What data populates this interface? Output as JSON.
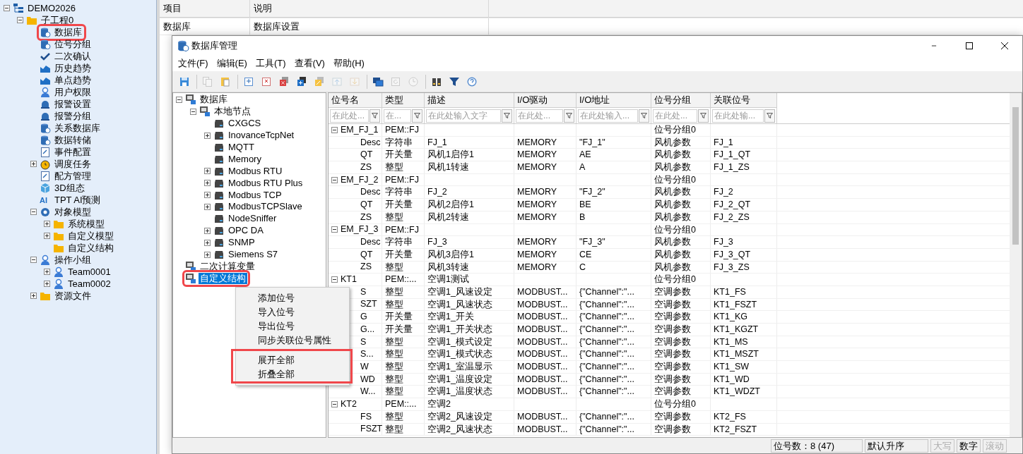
{
  "project_tree": [
    {
      "label": "DEMO2026",
      "kind": "hierarchy",
      "expanded": true,
      "highlighted": false,
      "children": [
        {
          "label": "子工程0",
          "kind": "folder",
          "expanded": true,
          "highlighted": false,
          "children": [
            {
              "label": "数据库",
              "kind": "cylinder",
              "highlighted": true
            },
            {
              "label": "位号分组",
              "kind": "cylinder",
              "highlighted": false
            },
            {
              "label": "二次确认",
              "kind": "checkmark",
              "highlighted": false
            },
            {
              "label": "历史趋势",
              "kind": "chart",
              "highlighted": false
            },
            {
              "label": "单点趋势",
              "kind": "chart",
              "highlighted": false
            },
            {
              "label": "用户权限",
              "kind": "user",
              "highlighted": false
            },
            {
              "label": "报警设置",
              "kind": "bell",
              "highlighted": false
            },
            {
              "label": "报警分组",
              "kind": "bell",
              "highlighted": false
            },
            {
              "label": "关系数据库",
              "kind": "cylinder",
              "highlighted": false
            },
            {
              "label": "数据转储",
              "kind": "cylinder",
              "highlighted": false
            },
            {
              "label": "事件配置",
              "kind": "document",
              "highlighted": false
            },
            {
              "label": "调度任务",
              "kind": "clock",
              "expanded": false,
              "highlighted": false
            },
            {
              "label": "配方管理",
              "kind": "document",
              "highlighted": false
            },
            {
              "label": "3D组态",
              "kind": "cube",
              "highlighted": false
            },
            {
              "label": "TPT AI预测",
              "kind": "text",
              "icon_text": "AI",
              "highlighted": false
            },
            {
              "label": "对象模型",
              "kind": "target",
              "expanded": true,
              "highlighted": false,
              "children": [
                {
                  "label": "系统模型",
                  "kind": "folder",
                  "expanded": false,
                  "highlighted": false
                },
                {
                  "label": "自定义模型",
                  "kind": "folder",
                  "expanded": false,
                  "highlighted": false
                },
                {
                  "label": "自定义结构",
                  "kind": "folder",
                  "highlighted": false
                }
              ]
            },
            {
              "label": "操作小组",
              "kind": "user",
              "expanded": true,
              "highlighted": false,
              "children": [
                {
                  "label": "Team0001",
                  "kind": "user",
                  "expanded": false,
                  "highlighted": false
                },
                {
                  "label": "Team0002",
                  "kind": "user",
                  "expanded": false,
                  "highlighted": false
                }
              ]
            },
            {
              "label": "资源文件",
              "kind": "folder",
              "expanded": false,
              "highlighted": false
            }
          ]
        }
      ]
    }
  ],
  "settings_list": {
    "columns": [
      "项目",
      "说明"
    ],
    "rows": [
      [
        "数据库",
        "数据库设置"
      ]
    ]
  },
  "dialog": {
    "title": "数据库管理",
    "menu": [
      "文件(F)",
      "编辑(E)",
      "工具(T)",
      "查看(V)",
      "帮助(H)"
    ],
    "toolbar": [
      {
        "kind": "save",
        "disabled": false
      },
      {
        "kind": "separator"
      },
      {
        "kind": "copy",
        "disabled": true
      },
      {
        "kind": "paste",
        "disabled": false
      },
      {
        "kind": "separator"
      },
      {
        "kind": "add",
        "disabled": false
      },
      {
        "kind": "delete",
        "disabled": false
      },
      {
        "kind": "remove",
        "disabled": false
      },
      {
        "kind": "insert",
        "disabled": false
      },
      {
        "kind": "edit",
        "disabled": false
      },
      {
        "kind": "up",
        "disabled": true
      },
      {
        "kind": "down",
        "disabled": true
      },
      {
        "kind": "separator"
      },
      {
        "kind": "monitor",
        "disabled": false
      },
      {
        "kind": "refresh",
        "disabled": true
      },
      {
        "kind": "history",
        "disabled": true
      },
      {
        "kind": "separator"
      },
      {
        "kind": "find",
        "disabled": false
      },
      {
        "kind": "filter",
        "disabled": false
      },
      {
        "kind": "help",
        "disabled": false
      }
    ],
    "tree": [
      {
        "label": "数据库",
        "kind": "computer",
        "expanded": true,
        "selected": false,
        "highlighted": false,
        "children": [
          {
            "label": "本地节点",
            "kind": "computer",
            "expanded": true,
            "selected": false,
            "highlighted": false,
            "children": [
              {
                "label": "CXGCS",
                "kind": "device",
                "selected": false,
                "highlighted": false
              },
              {
                "label": "InovanceTcpNet",
                "kind": "device",
                "expanded": false,
                "selected": false,
                "highlighted": false
              },
              {
                "label": "MQTT",
                "kind": "device",
                "selected": false,
                "highlighted": false
              },
              {
                "label": "Memory",
                "kind": "device",
                "selected": false,
                "highlighted": false
              },
              {
                "label": "Modbus RTU",
                "kind": "device",
                "expanded": false,
                "selected": false,
                "highlighted": false
              },
              {
                "label": "Modbus RTU Plus",
                "kind": "device",
                "expanded": false,
                "selected": false,
                "highlighted": false
              },
              {
                "label": "Modbus TCP",
                "kind": "device",
                "expanded": false,
                "selected": false,
                "highlighted": false
              },
              {
                "label": "ModbusTCPSlave",
                "kind": "device",
                "expanded": false,
                "selected": false,
                "highlighted": false
              },
              {
                "label": "NodeSniffer",
                "kind": "device",
                "selected": false,
                "highlighted": false
              },
              {
                "label": "OPC DA",
                "kind": "device",
                "expanded": false,
                "selected": false,
                "highlighted": false
              },
              {
                "label": "SNMP",
                "kind": "device",
                "expanded": false,
                "selected": false,
                "highlighted": false
              },
              {
                "label": "Siemens S7",
                "kind": "device",
                "expanded": false,
                "selected": false,
                "highlighted": false
              }
            ]
          }
        ]
      },
      {
        "label": "二次计算变量",
        "kind": "computer",
        "selected": false,
        "highlighted": false
      },
      {
        "label": "自定义结构",
        "kind": "computer",
        "selected": true,
        "highlighted": true
      }
    ],
    "columns": [
      {
        "label": "位号名",
        "placeholder": "在此处..."
      },
      {
        "label": "类型",
        "placeholder": "在..."
      },
      {
        "label": "描述",
        "placeholder": "在此处输入文字"
      },
      {
        "label": "I/O驱动",
        "placeholder": "在此处..."
      },
      {
        "label": "I/O地址",
        "placeholder": "在此处输入..."
      },
      {
        "label": "位号分组",
        "placeholder": "在此处..."
      },
      {
        "label": "关联位号",
        "placeholder": "在此处输..."
      }
    ],
    "groups": [
      {
        "name": "EM_FJ_1",
        "type": "PEM::FJ",
        "group": "位号分组0",
        "expanded": true,
        "children": [
          {
            "name": "Desc",
            "type": "字符串",
            "description": "FJ_1",
            "driver": "MEMORY",
            "address": "\"FJ_1\"",
            "group": "风机参数",
            "linked": "FJ_1"
          },
          {
            "name": "QT",
            "type": "开关量",
            "description": "风机1启停1",
            "driver": "MEMORY",
            "address": "AE",
            "group": "风机参数",
            "linked": "FJ_1_QT"
          },
          {
            "name": "ZS",
            "type": "整型",
            "description": "风机1转速",
            "driver": "MEMORY",
            "address": "A",
            "group": "风机参数",
            "linked": "FJ_1_ZS"
          }
        ]
      },
      {
        "name": "EM_FJ_2",
        "type": "PEM::FJ",
        "group": "位号分组0",
        "expanded": true,
        "children": [
          {
            "name": "Desc",
            "type": "字符串",
            "description": "FJ_2",
            "driver": "MEMORY",
            "address": "\"FJ_2\"",
            "group": "风机参数",
            "linked": "FJ_2"
          },
          {
            "name": "QT",
            "type": "开关量",
            "description": "风机2启停1",
            "driver": "MEMORY",
            "address": "BE",
            "group": "风机参数",
            "linked": "FJ_2_QT"
          },
          {
            "name": "ZS",
            "type": "整型",
            "description": "风机2转速",
            "driver": "MEMORY",
            "address": "B",
            "group": "风机参数",
            "linked": "FJ_2_ZS"
          }
        ]
      },
      {
        "name": "EM_FJ_3",
        "type": "PEM::FJ",
        "group": "位号分组0",
        "expanded": true,
        "children": [
          {
            "name": "Desc",
            "type": "字符串",
            "description": "FJ_3",
            "driver": "MEMORY",
            "address": "\"FJ_3\"",
            "group": "风机参数",
            "linked": "FJ_3"
          },
          {
            "name": "QT",
            "type": "开关量",
            "description": "风机3启停1",
            "driver": "MEMORY",
            "address": "CE",
            "group": "风机参数",
            "linked": "FJ_3_QT"
          },
          {
            "name": "ZS",
            "type": "整型",
            "description": "风机3转速",
            "driver": "MEMORY",
            "address": "C",
            "group": "风机参数",
            "linked": "FJ_3_ZS"
          }
        ]
      },
      {
        "name": "KT1",
        "type": "PEM::...",
        "description": "空调1测试",
        "group": "位号分组0",
        "expanded": true,
        "children": [
          {
            "name": "S",
            "type": "整型",
            "description": "空调1_风速设定",
            "driver": "MODBUST...",
            "address": "{\"Channel\":\"...",
            "group": "空调参数",
            "linked": "KT1_FS"
          },
          {
            "name": "SZT",
            "type": "整型",
            "description": "空调1_风速状态",
            "driver": "MODBUST...",
            "address": "{\"Channel\":\"...",
            "group": "空调参数",
            "linked": "KT1_FSZT"
          },
          {
            "name": "G",
            "type": "开关量",
            "description": "空调1_开关",
            "driver": "MODBUST...",
            "address": "{\"Channel\":\"...",
            "group": "空调参数",
            "linked": "KT1_KG"
          },
          {
            "name": "G...",
            "type": "开关量",
            "description": "空调1_开关状态",
            "driver": "MODBUST...",
            "address": "{\"Channel\":\"...",
            "group": "空调参数",
            "linked": "KT1_KGZT"
          },
          {
            "name": "S",
            "type": "整型",
            "description": "空调1_模式设定",
            "driver": "MODBUST...",
            "address": "{\"Channel\":\"...",
            "group": "空调参数",
            "linked": "KT1_MS"
          },
          {
            "name": "S...",
            "type": "整型",
            "description": "空调1_模式状态",
            "driver": "MODBUST...",
            "address": "{\"Channel\":\"...",
            "group": "空调参数",
            "linked": "KT1_MSZT"
          },
          {
            "name": "W",
            "type": "整型",
            "description": "空调1_室温显示",
            "driver": "MODBUST...",
            "address": "{\"Channel\":\"...",
            "group": "空调参数",
            "linked": "KT1_SW"
          },
          {
            "name": "WD",
            "type": "整型",
            "description": "空调1_温度设定",
            "driver": "MODBUST...",
            "address": "{\"Channel\":\"...",
            "group": "空调参数",
            "linked": "KT1_WD"
          },
          {
            "name": "W...",
            "type": "整型",
            "description": "空调1_温度状态",
            "driver": "MODBUST...",
            "address": "{\"Channel\":\"...",
            "group": "空调参数",
            "linked": "KT1_WDZT"
          }
        ]
      },
      {
        "name": "KT2",
        "type": "PEM::...",
        "description": "空调2",
        "group": "位号分组0",
        "expanded": true,
        "children": [
          {
            "name": "FS",
            "type": "整型",
            "description": "空调2_风速设定",
            "driver": "MODBUST...",
            "address": "{\"Channel\":\"...",
            "group": "空调参数",
            "linked": "KT2_FS"
          },
          {
            "name": "FSZT",
            "type": "整型",
            "description": "空调2_风速状态",
            "driver": "MODBUST...",
            "address": "{\"Channel\":\"...",
            "group": "空调参数",
            "linked": "KT2_FSZT"
          }
        ]
      }
    ],
    "context_menu": {
      "groups": [
        {
          "highlighted": false,
          "items": [
            "添加位号",
            "导入位号",
            "导出位号",
            "同步关联位号属性"
          ]
        },
        {
          "highlighted": true,
          "items": [
            "展开全部",
            "折叠全部"
          ]
        }
      ]
    },
    "status_bar": {
      "count": "位号数：8 (47)",
      "sort": "默认升序",
      "indicators": [
        {
          "label": "大写",
          "on": false
        },
        {
          "label": "数字",
          "on": true
        },
        {
          "label": "滚动",
          "on": false
        }
      ]
    }
  }
}
